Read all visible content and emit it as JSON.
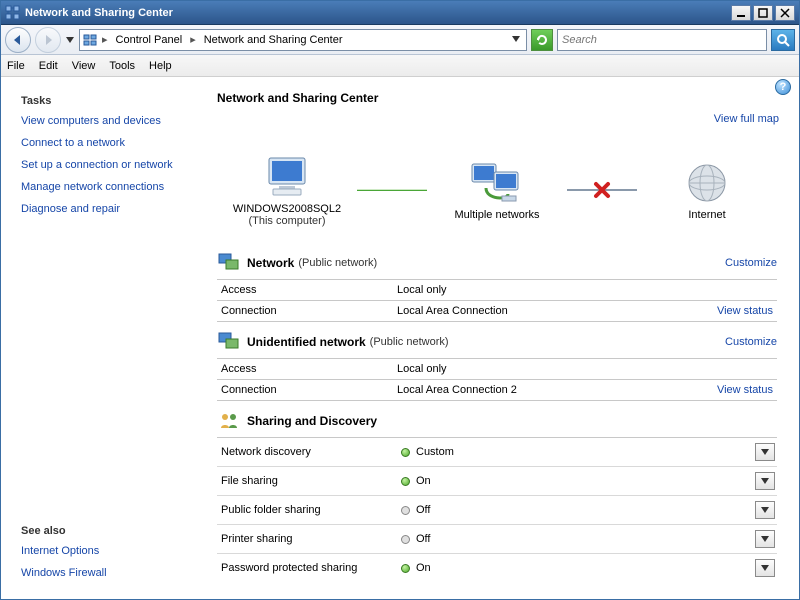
{
  "window": {
    "title": "Network and Sharing Center"
  },
  "breadcrumb": {
    "item1": "Control Panel",
    "item2": "Network and Sharing Center"
  },
  "search": {
    "placeholder": "Search"
  },
  "menubar": {
    "file": "File",
    "edit": "Edit",
    "view": "View",
    "tools": "Tools",
    "help": "Help"
  },
  "tasks": {
    "heading": "Tasks",
    "items": [
      "View computers and devices",
      "Connect to a network",
      "Set up a connection or network",
      "Manage network connections",
      "Diagnose and repair"
    ]
  },
  "see_also": {
    "heading": "See also",
    "items": [
      "Internet Options",
      "Windows Firewall"
    ]
  },
  "main": {
    "heading": "Network and Sharing Center",
    "view_full_map": "View full map",
    "nodes": {
      "computer": {
        "label": "WINDOWS2008SQL2",
        "sub": "(This computer)"
      },
      "middle": {
        "label": "Multiple networks"
      },
      "internet": {
        "label": "Internet"
      }
    }
  },
  "networks": [
    {
      "title": "Network",
      "type": "(Public network)",
      "customize": "Customize",
      "rows": [
        {
          "label": "Access",
          "value": "Local only",
          "link": ""
        },
        {
          "label": "Connection",
          "value": "Local Area Connection",
          "link": "View status"
        }
      ]
    },
    {
      "title": "Unidentified network",
      "type": "(Public network)",
      "customize": "Customize",
      "rows": [
        {
          "label": "Access",
          "value": "Local only",
          "link": ""
        },
        {
          "label": "Connection",
          "value": "Local Area Connection 2",
          "link": "View status"
        }
      ]
    }
  ],
  "sharing": {
    "heading": "Sharing and Discovery",
    "rows": [
      {
        "label": "Network discovery",
        "value": "Custom",
        "status": "on"
      },
      {
        "label": "File sharing",
        "value": "On",
        "status": "on"
      },
      {
        "label": "Public folder sharing",
        "value": "Off",
        "status": "off"
      },
      {
        "label": "Printer sharing",
        "value": "Off",
        "status": "off"
      },
      {
        "label": "Password protected sharing",
        "value": "On",
        "status": "on"
      }
    ]
  }
}
